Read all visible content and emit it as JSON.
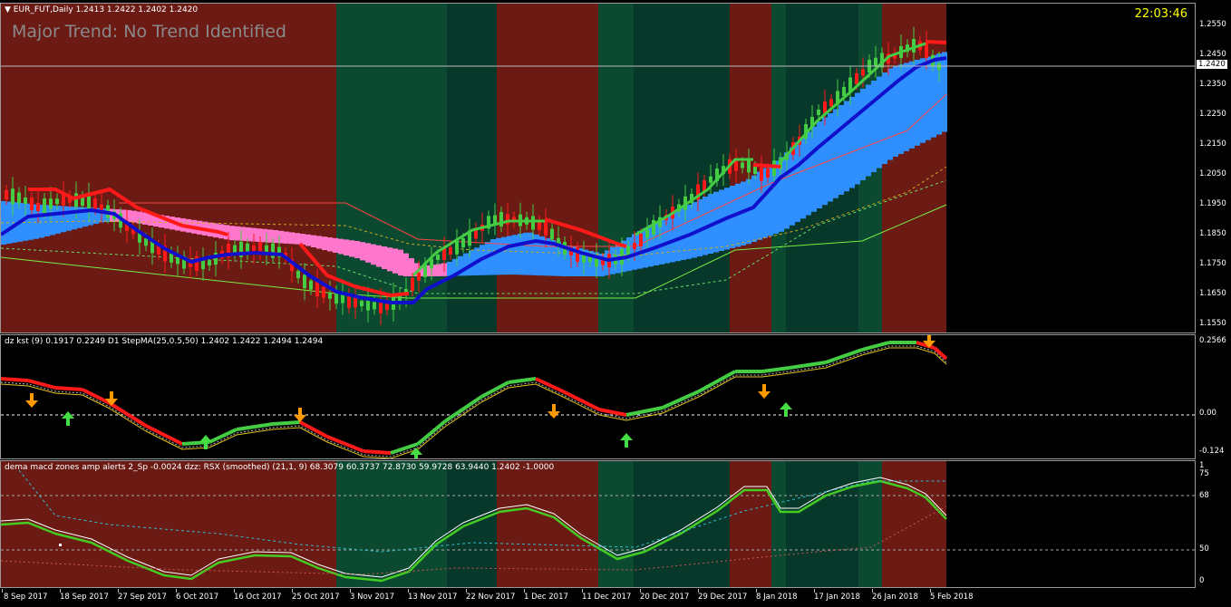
{
  "chart": {
    "symbol_header": "EUR_FUT,Daily  1.2413 1.2422 1.2402 1.2420",
    "trend_label": "Major Trend: No Trend Identified",
    "clock": "22:03:46",
    "current_price": "1.2420"
  },
  "kst": {
    "header": "dz kst (9) 0.1917 0.2249  D1 StepMA(25,0.5,50) 1.2402 1.2422 1.2494 1.2494"
  },
  "rsx": {
    "header": "dema macd zones amp alerts 2_Sp -0.0024  dzz:  RSX (smoothed) (21,1, 9) 68.3079 60.3737 72.8730 59.9728 63.9440 1.2402 -1.0000"
  },
  "price_axis": [
    "1.2550",
    "1.2450",
    "1.2350",
    "1.2250",
    "1.2150",
    "1.2050",
    "1.1950",
    "1.1850",
    "1.1750",
    "1.1650",
    "1.1550"
  ],
  "kst_axis": [
    "0.2566",
    "0.00",
    "-0.124"
  ],
  "rsx_axis": [
    "1",
    "75",
    "68",
    "50",
    "0"
  ],
  "dates": [
    "8 Sep 2017",
    "18 Sep 2017",
    "27 Sep 2017",
    "6 Oct 2017",
    "16 Oct 2017",
    "25 Oct 2017",
    "3 Nov 2017",
    "13 Nov 2017",
    "22 Nov 2017",
    "1 Dec 2017",
    "11 Dec 2017",
    "20 Dec 2017",
    "29 Dec 2017",
    "8 Jan 2018",
    "17 Jan 2018",
    "26 Jan 2018",
    "5 Feb 2018"
  ],
  "zones": [
    {
      "start": 0,
      "end": 370,
      "color": "#6b1a14"
    },
    {
      "start": 370,
      "end": 492,
      "color": "#0b4a30"
    },
    {
      "start": 492,
      "end": 547,
      "color": "#08382a"
    },
    {
      "start": 547,
      "end": 659,
      "color": "#6b1a14"
    },
    {
      "start": 659,
      "end": 698,
      "color": "#0b4a30"
    },
    {
      "start": 698,
      "end": 804,
      "color": "#08382a"
    },
    {
      "start": 804,
      "end": 850,
      "color": "#6b1a14"
    },
    {
      "start": 850,
      "end": 866,
      "color": "#0b4a30"
    },
    {
      "start": 866,
      "end": 946,
      "color": "#08382a"
    },
    {
      "start": 946,
      "end": 972,
      "color": "#0b4a30"
    },
    {
      "start": 972,
      "end": 1043,
      "color": "#6b1a14"
    }
  ],
  "colors": {
    "background": "#000000",
    "bull": "#44cc44",
    "bear": "#ff1a1a",
    "trend_blue": "#1010cc",
    "band_blue": "#2f8fff",
    "band_pink": "#ff77cc",
    "arrow_down": "#ff9900",
    "arrow_up": "#44dd44",
    "clock": "#ffff00"
  },
  "icons": [
    "arrow-up-icon",
    "arrow-down-icon",
    "dropdown-triangle-icon"
  ]
}
